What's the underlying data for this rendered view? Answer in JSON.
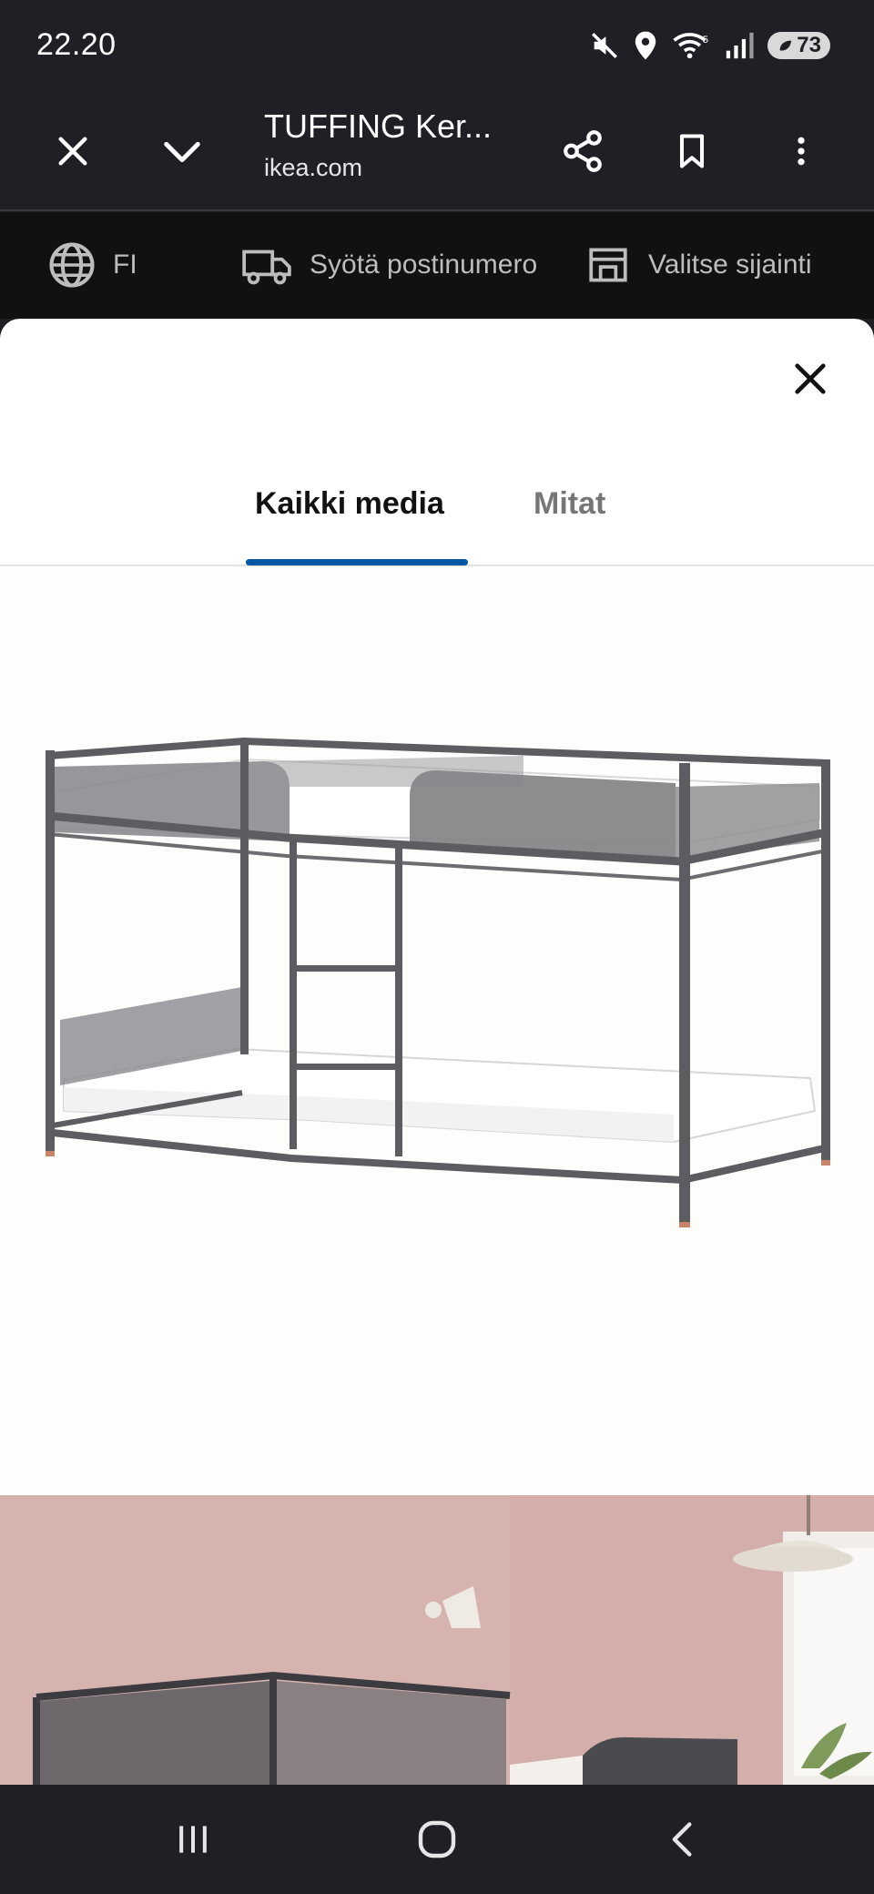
{
  "status_bar": {
    "time": "22.20",
    "battery": "73",
    "icons": [
      "mute-icon",
      "location-icon",
      "wifi-icon",
      "signal-icon",
      "battery-icon"
    ]
  },
  "browser": {
    "page_title": "TUFFING Ker...",
    "domain": "ikea.com",
    "icons": [
      "close-icon",
      "chevron-down-icon",
      "share-icon",
      "bookmark-icon",
      "more-vert-icon"
    ]
  },
  "site_header": {
    "language": "FI",
    "postcode": "Syötä postinumero",
    "store": "Valitse sijainti"
  },
  "gallery": {
    "tabs": [
      {
        "label": "Kaikki media",
        "active": true
      },
      {
        "label": "Mitat",
        "active": false
      }
    ]
  },
  "colors": {
    "accent": "#0058a3",
    "chrome": "#1f2025",
    "site_header_bg": "#111111",
    "room_wall": "#d9b6b3"
  }
}
